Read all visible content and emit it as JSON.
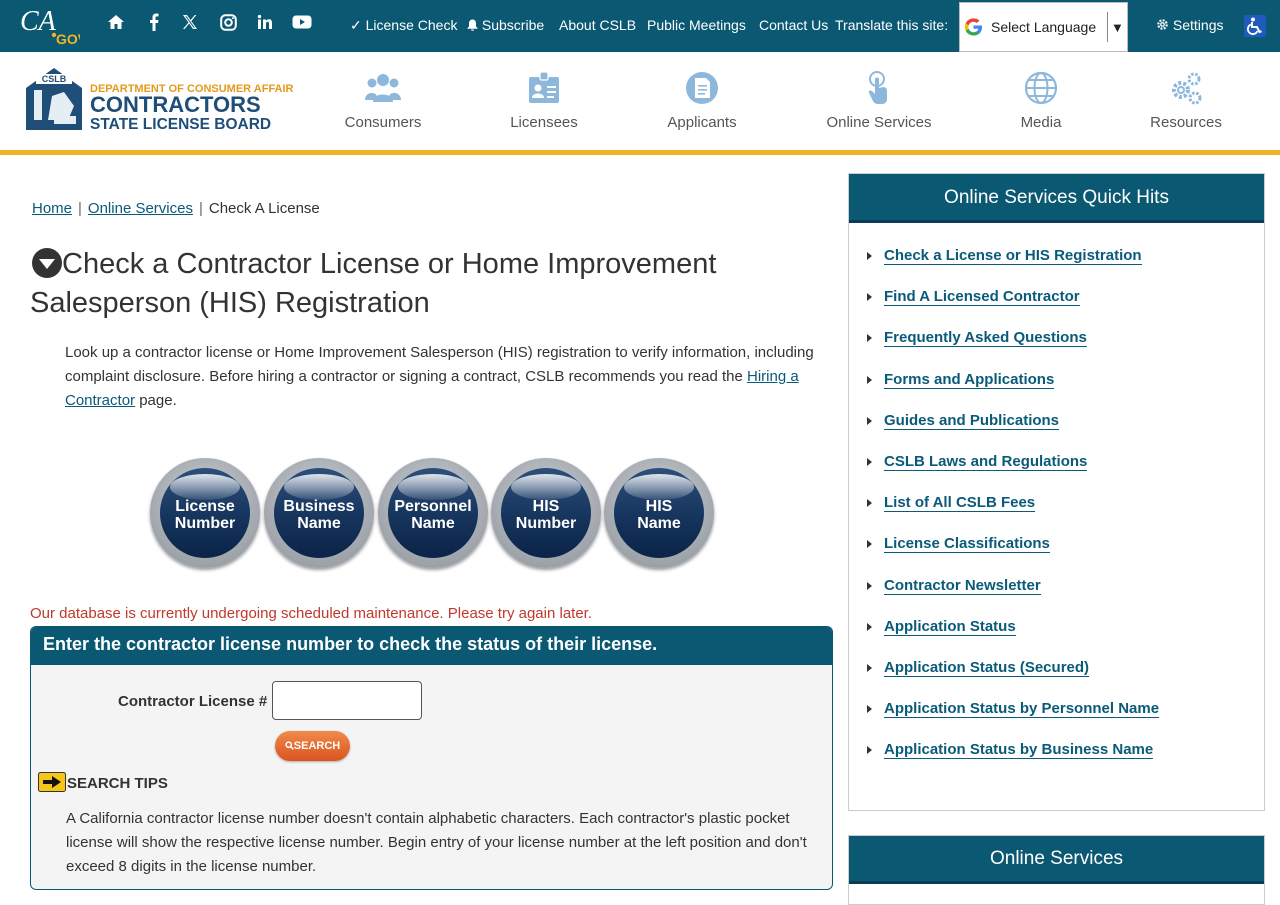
{
  "topbar": {
    "cagov_logo": "CA.GOV",
    "social_icons": [
      "home-icon",
      "facebook-icon",
      "x-icon",
      "instagram-icon",
      "linkedin-icon",
      "youtube-icon"
    ],
    "links": {
      "license_check": "✓ License Check",
      "subscribe": "Subscribe",
      "about": "About CSLB",
      "public_meetings": "Public Meetings",
      "contact": "Contact Us",
      "translate": "Translate this site:"
    },
    "language": {
      "selected": "Select Language",
      "arrow": "▼"
    },
    "settings": "Settings"
  },
  "header": {
    "logo": {
      "line1": "DEPARTMENT OF CONSUMER AFFAIRS",
      "line2": "CONTRACTORS",
      "line3": "STATE LICENSE BOARD",
      "badge": "CSLB"
    },
    "nav": [
      "Consumers",
      "Licensees",
      "Applicants",
      "Online Services",
      "Media",
      "Resources"
    ]
  },
  "breadcrumb": {
    "home": "Home",
    "online_services": "Online Services",
    "current": "Check A License"
  },
  "page": {
    "title": "Check a Contractor License or Home Improvement Salesperson (HIS) Registration",
    "intro_text": "Look up a contractor license or Home Improvement Salesperson (HIS) registration to verify information, including complaint disclosure. Before hiring a contractor or signing a contract, CSLB recommends you read the ",
    "intro_link": "Hiring a Contractor",
    "intro_end": " page."
  },
  "search_buttons": [
    {
      "line1": "License",
      "line2": "Number"
    },
    {
      "line1": "Business",
      "line2": "Name"
    },
    {
      "line1": "Personnel",
      "line2": "Name"
    },
    {
      "line1": "HIS",
      "line2": "Number"
    },
    {
      "line1": "HIS",
      "line2": "Name"
    }
  ],
  "maintenance_notice": "Our database is currently undergoing scheduled maintenance. Please try again later.",
  "form": {
    "heading": "Enter the contractor license number to check the status of their license.",
    "label": "Contractor License #",
    "input_value": "",
    "search_label": "SEARCH",
    "tips_label": "SEARCH TIPS",
    "tips_text": "A California contractor license number doesn't contain alphabetic characters. Each contractor's plastic pocket license will show the respective license number. Begin entry of your license number at the left position and don't exceed 8 digits in the license number."
  },
  "sidebar": {
    "title": "Online Services Quick Hits",
    "items": [
      "Check a License or HIS Registration",
      "Find A Licensed Contractor",
      "Frequently Asked Questions",
      "Forms and Applications",
      "Guides and Publications",
      "CSLB Laws and Regulations",
      "List of All CSLB Fees",
      "License Classifications",
      "Contractor Newsletter",
      "Application Status",
      "Application Status (Secured)",
      "Application Status by Personnel Name",
      "Application Status by Business Name"
    ],
    "second_title": "Online Services"
  },
  "colors": {
    "primary": "#0b5873",
    "gold": "#f0b429",
    "alert": "#c0392b",
    "search": "#e06a2c"
  }
}
